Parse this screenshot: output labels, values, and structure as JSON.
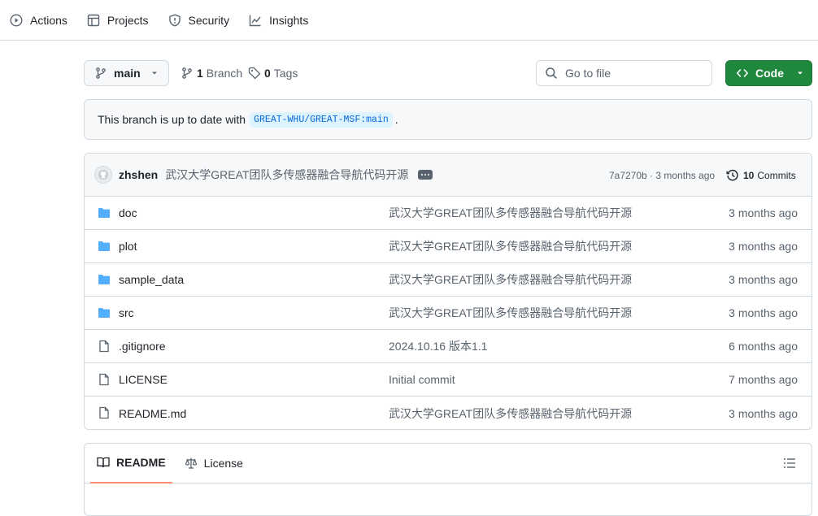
{
  "nav": {
    "tabs": [
      {
        "label": "Actions",
        "icon": "play-circle-icon"
      },
      {
        "label": "Projects",
        "icon": "table-icon"
      },
      {
        "label": "Security",
        "icon": "shield-icon"
      },
      {
        "label": "Insights",
        "icon": "graph-icon"
      }
    ]
  },
  "toolbar": {
    "branch": "main",
    "branch_count": "1",
    "branch_label": "Branch",
    "tag_count": "0",
    "tag_label": "Tags",
    "search_placeholder": "Go to file",
    "code_label": "Code"
  },
  "status": {
    "text_before": "This branch is up to date with",
    "ref": "GREAT-WHU/GREAT-MSF:main",
    "text_after": "."
  },
  "latest_commit": {
    "author": "zhshen",
    "message": "武汉大学GREAT团队多传感器融合导航代码开源",
    "hash_and_time": "7a7270b · 3 months ago",
    "commit_count": "10",
    "commit_label": "Commits"
  },
  "files": [
    {
      "name": "doc",
      "type": "folder",
      "message": "武汉大学GREAT团队多传感器融合导航代码开源",
      "date": "3 months ago"
    },
    {
      "name": "plot",
      "type": "folder",
      "message": "武汉大学GREAT团队多传感器融合导航代码开源",
      "date": "3 months ago"
    },
    {
      "name": "sample_data",
      "type": "folder",
      "message": "武汉大学GREAT团队多传感器融合导航代码开源",
      "date": "3 months ago"
    },
    {
      "name": "src",
      "type": "folder",
      "message": "武汉大学GREAT团队多传感器融合导航代码开源",
      "date": "3 months ago"
    },
    {
      "name": ".gitignore",
      "type": "file",
      "message": "2024.10.16 版本1.1",
      "date": "6 months ago"
    },
    {
      "name": "LICENSE",
      "type": "file",
      "message": "Initial commit",
      "date": "7 months ago"
    },
    {
      "name": "README.md",
      "type": "file",
      "message": "武汉大学GREAT团队多传感器融合导航代码开源",
      "date": "3 months ago"
    }
  ],
  "readme": {
    "tabs": [
      {
        "label": "README",
        "icon": "book-icon"
      },
      {
        "label": "License",
        "icon": "law-icon"
      }
    ]
  },
  "colors": {
    "primary_button": "#1f883d",
    "folder": "#54aeff",
    "link": "#0969da",
    "active_tab_underline": "#fd8c73"
  }
}
